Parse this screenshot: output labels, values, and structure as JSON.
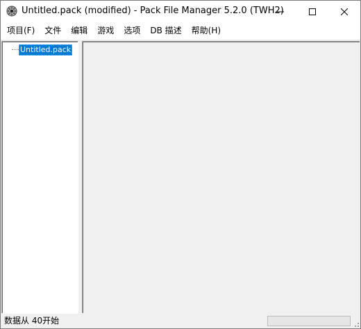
{
  "window": {
    "title": "Untitled.pack (modified) - Pack File Manager 5.2.0 (TWH2)"
  },
  "menu": {
    "items": [
      {
        "label": "项目(F)"
      },
      {
        "label": "文件"
      },
      {
        "label": "编辑"
      },
      {
        "label": "游戏"
      },
      {
        "label": "选项"
      },
      {
        "label": "DB 描述"
      },
      {
        "label": "帮助(H)"
      }
    ]
  },
  "tree": {
    "root_label": "Untitled.pack"
  },
  "status": {
    "text": "数据从 40开始",
    "progress": 0
  },
  "colors": {
    "selection": "#0078d7",
    "chrome": "#f0f0f0",
    "titlebar": "#ffffff"
  },
  "icons": {
    "app": "pack-file-manager-icon",
    "minimize": "minimize-icon",
    "maximize": "maximize-icon",
    "close": "close-icon"
  }
}
